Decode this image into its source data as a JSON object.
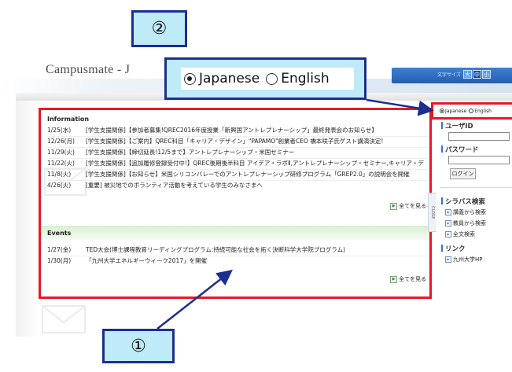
{
  "header": {
    "logo_text": "Campusmate - J",
    "font_size_label": "文字サイズ",
    "font_size_small": "大",
    "font_size_mid": "中",
    "font_size_large": "小"
  },
  "callouts": {
    "one": "①",
    "two": "②"
  },
  "language_zoom": {
    "japanese": "Japanese",
    "english": "English",
    "selected": "Japanese"
  },
  "information": {
    "title": "Information",
    "see_all": "全てを見る",
    "items": [
      {
        "date": "1/25(水)",
        "text": "[学生支援関係]【参加者募集!QREC2016年度授業「新興国アントレプレナーシップ」最終発表会のお知らせ】"
      },
      {
        "date": "12/26(月)",
        "text": "[学生支援関係]【ご案内】QREC科目「キャリア・デザイン」\"PAPAMO\"創業者CEO 橋本咲子氏ゲスト講演決定!"
      },
      {
        "date": "11/29(火)",
        "text": "[学生支援関係]【締切延長!12/5まで】アントレプレナーシップ・米国セミナー"
      },
      {
        "date": "11/22(火)",
        "text": "[学生支援関係]【追加履修登録受付中!】QREC後期後半科目 アイデア・ラボⅡ,アントレプレナーシップ・セミナー,キャリア・デ"
      },
      {
        "date": "11/8(火)",
        "text": "[学生支援関係]【お知らせ】米国シリコンバレーでのアントレプレナーシップ研修プログラム「GREP2.0」の説明会を開催"
      },
      {
        "date": "4/26(火)",
        "text": "[重要] 被災地でのボランティア活動を考えている学生のみなさまへ"
      }
    ]
  },
  "events": {
    "title": "Events",
    "see_all": "全てを見る",
    "items": [
      {
        "date": "1/27(金)",
        "text": "TED大会(博士課程教育リーディングプログラム:持続可能な社会を拓く決断科学大学院プログラム)"
      },
      {
        "date": "1/30(月)",
        "text": "「九州大学エネルギーウィーク2017」を開催"
      }
    ]
  },
  "sidebar": {
    "lang_japanese": "Japanese",
    "lang_english": "English",
    "user_id_label": "ユーザID",
    "password_label": "パスワード",
    "login_button": "ログイン",
    "close_tab": "CLOSE",
    "syllabus_title": "シラバス検索",
    "syllabus_links": [
      "講義から検索",
      "教員から検索",
      "全文検索"
    ],
    "links_title": "リンク",
    "links": [
      "九州大学HP"
    ]
  },
  "colors": {
    "highlight_red": "#e31b23",
    "callout_fill": "#bfeaf8",
    "callout_border": "#1c2f8f",
    "events_band": "#d8f0d2",
    "accent_blue": "#3a6fcf"
  }
}
